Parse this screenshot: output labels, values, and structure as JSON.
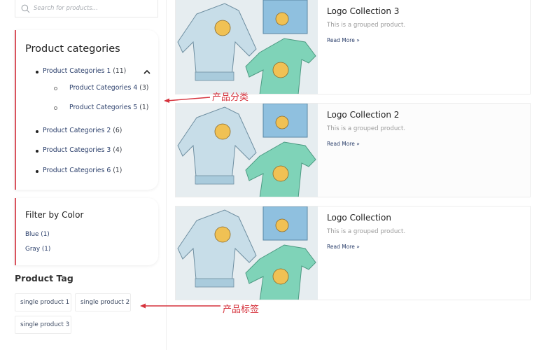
{
  "search": {
    "placeholder": "Search for products..."
  },
  "categories_widget": {
    "title": "Product categories",
    "items": [
      {
        "label": "Product Categories 1",
        "count": "(11)",
        "expanded": true,
        "children": [
          {
            "label": "Product Categories 4",
            "count": "(3)"
          },
          {
            "label": "Product Categories 5",
            "count": "(1)"
          }
        ]
      },
      {
        "label": "Product Categories 2",
        "count": "(6)"
      },
      {
        "label": "Product Categories 3",
        "count": "(4)"
      },
      {
        "label": "Product Categories 6",
        "count": "(1)"
      }
    ],
    "toggle_icon": "chevron-up-icon"
  },
  "color_widget": {
    "title": "Filter by Color",
    "items": [
      {
        "label": "Blue (1)"
      },
      {
        "label": "Gray (1)"
      }
    ]
  },
  "tag_widget": {
    "title": "Product Tag",
    "tags": [
      "single product 1",
      "single product 2",
      "single product 3"
    ]
  },
  "products": [
    {
      "title": "Logo Collection 3",
      "description": "This is a grouped product.",
      "link": "Read More »"
    },
    {
      "title": "Logo Collection 2",
      "description": "This is a grouped product.",
      "link": "Read More »"
    },
    {
      "title": "Logo Collection",
      "description": "This is a grouped product.",
      "link": "Read More »"
    }
  ],
  "annotations": {
    "categories_note": "产品分类",
    "tags_note": "产品标签",
    "color": "#d6323c"
  },
  "colors": {
    "accent_border": "#d9535d",
    "link": "#2b3f6b"
  }
}
